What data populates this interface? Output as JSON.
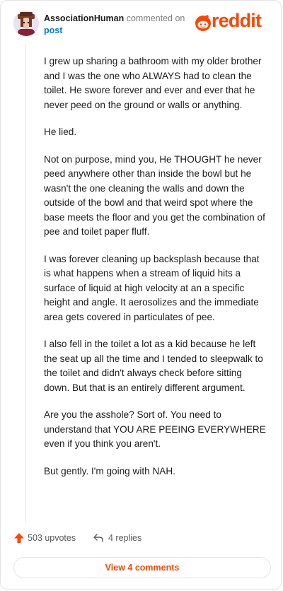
{
  "comment": {
    "username": "AssociationHuman",
    "action_text": "commented on",
    "post_link": "post",
    "paragraphs": [
      "I grew up sharing a bathroom with my older brother and I was the one who ALWAYS had to clean the toilet. He swore forever and ever and ever that he never peed on the ground or walls or anything.",
      "He lied.",
      "Not on purpose, mind you, He THOUGHT he never peed anywhere other than inside the bowl but he wasn't the one cleaning the walls and down the outside of the bowl and that weird spot where the base meets the floor and you get the combination of pee and toilet paper fluff.",
      "I was forever cleaning up backsplash because that is what happens when a stream of liquid hits a surface of liquid at high velocity at an a specific height and angle. It aerosolizes and the immediate area gets covered in particulates of pee.",
      "I also fell in the toilet a lot as a kid because he left the seat up all the time and I tended to sleepwalk to the toilet and didn't always check before sitting down. But that is an entirely different argument.",
      "Are you the asshole? Sort of. You need to understand that YOU ARE PEEING EVERYWHERE even if you think you aren't.",
      "But gently. I'm going with NAH."
    ]
  },
  "logo": {
    "text": "reddit",
    "color": "#ff4500"
  },
  "footer": {
    "upvotes": "503 upvotes",
    "replies": "4 replies",
    "upvote_icon": "upvote-arrow-icon",
    "reply_icon": "reply-arrow-icon"
  },
  "view_comments": "View 4 comments"
}
